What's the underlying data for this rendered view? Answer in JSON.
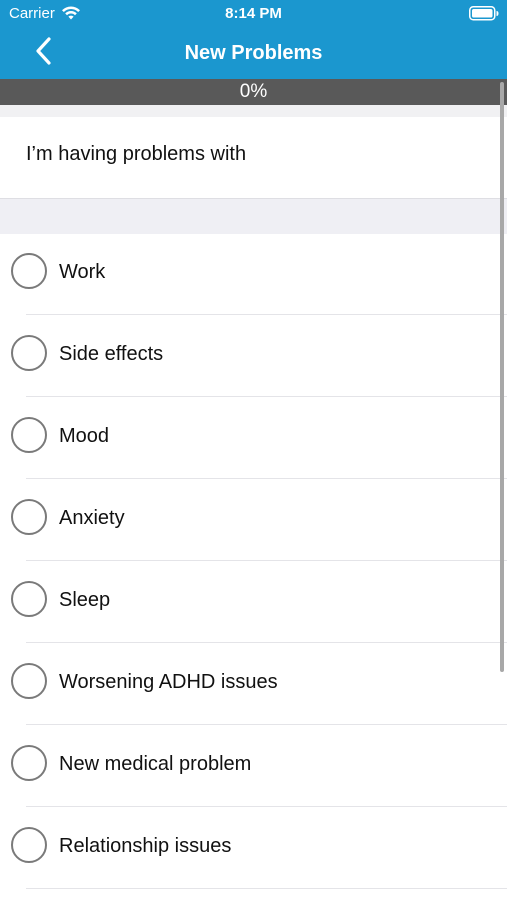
{
  "status_bar": {
    "carrier": "Carrier",
    "time": "8:14 PM",
    "wifi_icon": "wifi-icon",
    "battery_icon": "battery-full-icon"
  },
  "nav": {
    "title": "New Problems",
    "back_icon": "chevron-left-icon"
  },
  "progress": {
    "label": "0%",
    "value": 0
  },
  "question": {
    "text": "I’m having problems with"
  },
  "options": [
    {
      "label": "Work",
      "selected": false
    },
    {
      "label": "Side effects",
      "selected": false
    },
    {
      "label": "Mood",
      "selected": false
    },
    {
      "label": "Anxiety",
      "selected": false
    },
    {
      "label": "Sleep",
      "selected": false
    },
    {
      "label": "Worsening ADHD issues",
      "selected": false
    },
    {
      "label": "New medical problem",
      "selected": false
    },
    {
      "label": "Relationship issues",
      "selected": false
    }
  ],
  "colors": {
    "header": "#1b97cf",
    "progress_track": "#595959",
    "section_background": "#efeff4",
    "radio_border": "#7a7a7a"
  }
}
